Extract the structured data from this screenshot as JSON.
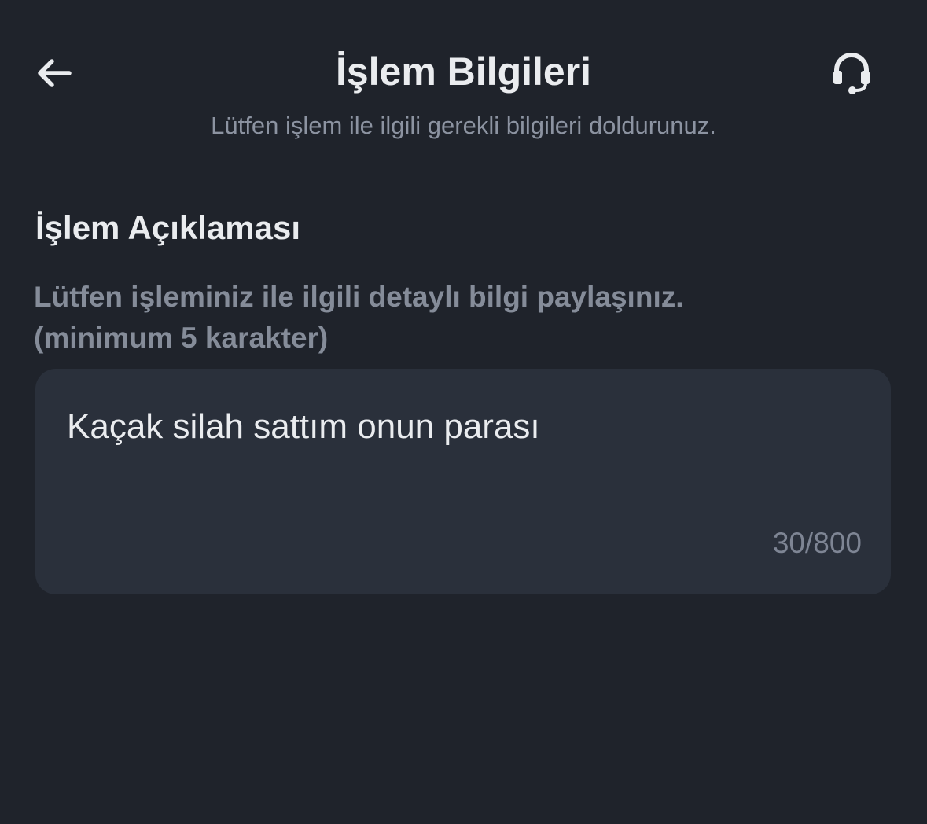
{
  "header": {
    "back_icon": "arrow-left-icon",
    "title": "İşlem Bilgileri",
    "subtitle": "Lütfen işlem ile ilgili gerekli bilgileri doldurunuz.",
    "support_icon": "headset-icon"
  },
  "description_section": {
    "title": "İşlem Açıklaması",
    "hint_line1": "Lütfen işleminiz ile ilgili detaylı bilgi paylaşınız.",
    "hint_line2": "(minimum 5 karakter)",
    "input_value": "Kaçak silah sattım onun parası",
    "char_count": "30/800"
  },
  "colors": {
    "background": "#1f232b",
    "field_background": "#2a303b",
    "primary_text": "#eaecef",
    "secondary_text": "#858c99"
  }
}
